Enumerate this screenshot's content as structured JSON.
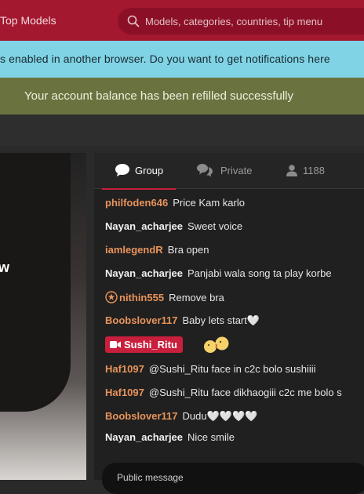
{
  "header": {
    "top_models": "Top Models",
    "search_placeholder": "Models, categories, countries, tip menu"
  },
  "notification_bar": {
    "text": "s enabled in another browser. Do you want to get notifications here"
  },
  "success_bar": {
    "text": "Your account balance has been refilled successfully"
  },
  "video": {
    "overlay_text": "w"
  },
  "chat": {
    "tabs": {
      "group": "Group",
      "private": "Private",
      "users_count": "1188"
    },
    "messages": [
      {
        "user": "philfoden646",
        "text": "Price Kam karlo"
      },
      {
        "user": "Nayan_acharjee",
        "text": "Sweet voice"
      },
      {
        "user": "iamlegendR",
        "text": "Bra open"
      },
      {
        "user": "Nayan_acharjee",
        "text": "Panjabi wala song ta play korbe"
      },
      {
        "user": "nithin555",
        "text": "Remove bra"
      },
      {
        "user": "Boobslover117",
        "text": "Baby lets start🤍"
      },
      {
        "user": "Sushi_Ritu",
        "text": ""
      },
      {
        "user": "Haf1097",
        "text": "@Sushi_Ritu  face in c2c bolo sushiiii"
      },
      {
        "user": "Haf1097",
        "text": "@Sushi_Ritu  face dikhaogiii c2c me bolo s"
      },
      {
        "user": "Boobslover117",
        "text": "Dudu🤍🤍🤍🤍"
      },
      {
        "user": "Nayan_acharjee",
        "text": "Nice smile"
      }
    ],
    "input_placeholder": "Public message"
  },
  "colors": {
    "brand": "#a3172f",
    "username_orange": "#e8945b",
    "accent_red": "#c81f3c",
    "notification": "#7fd3e5",
    "success": "#6a7340"
  },
  "icons": [
    "search-icon",
    "chat-bubble-icon",
    "private-chat-icon",
    "user-icon",
    "star-badge-icon",
    "camera-icon",
    "kiss-emoji-icon"
  ]
}
